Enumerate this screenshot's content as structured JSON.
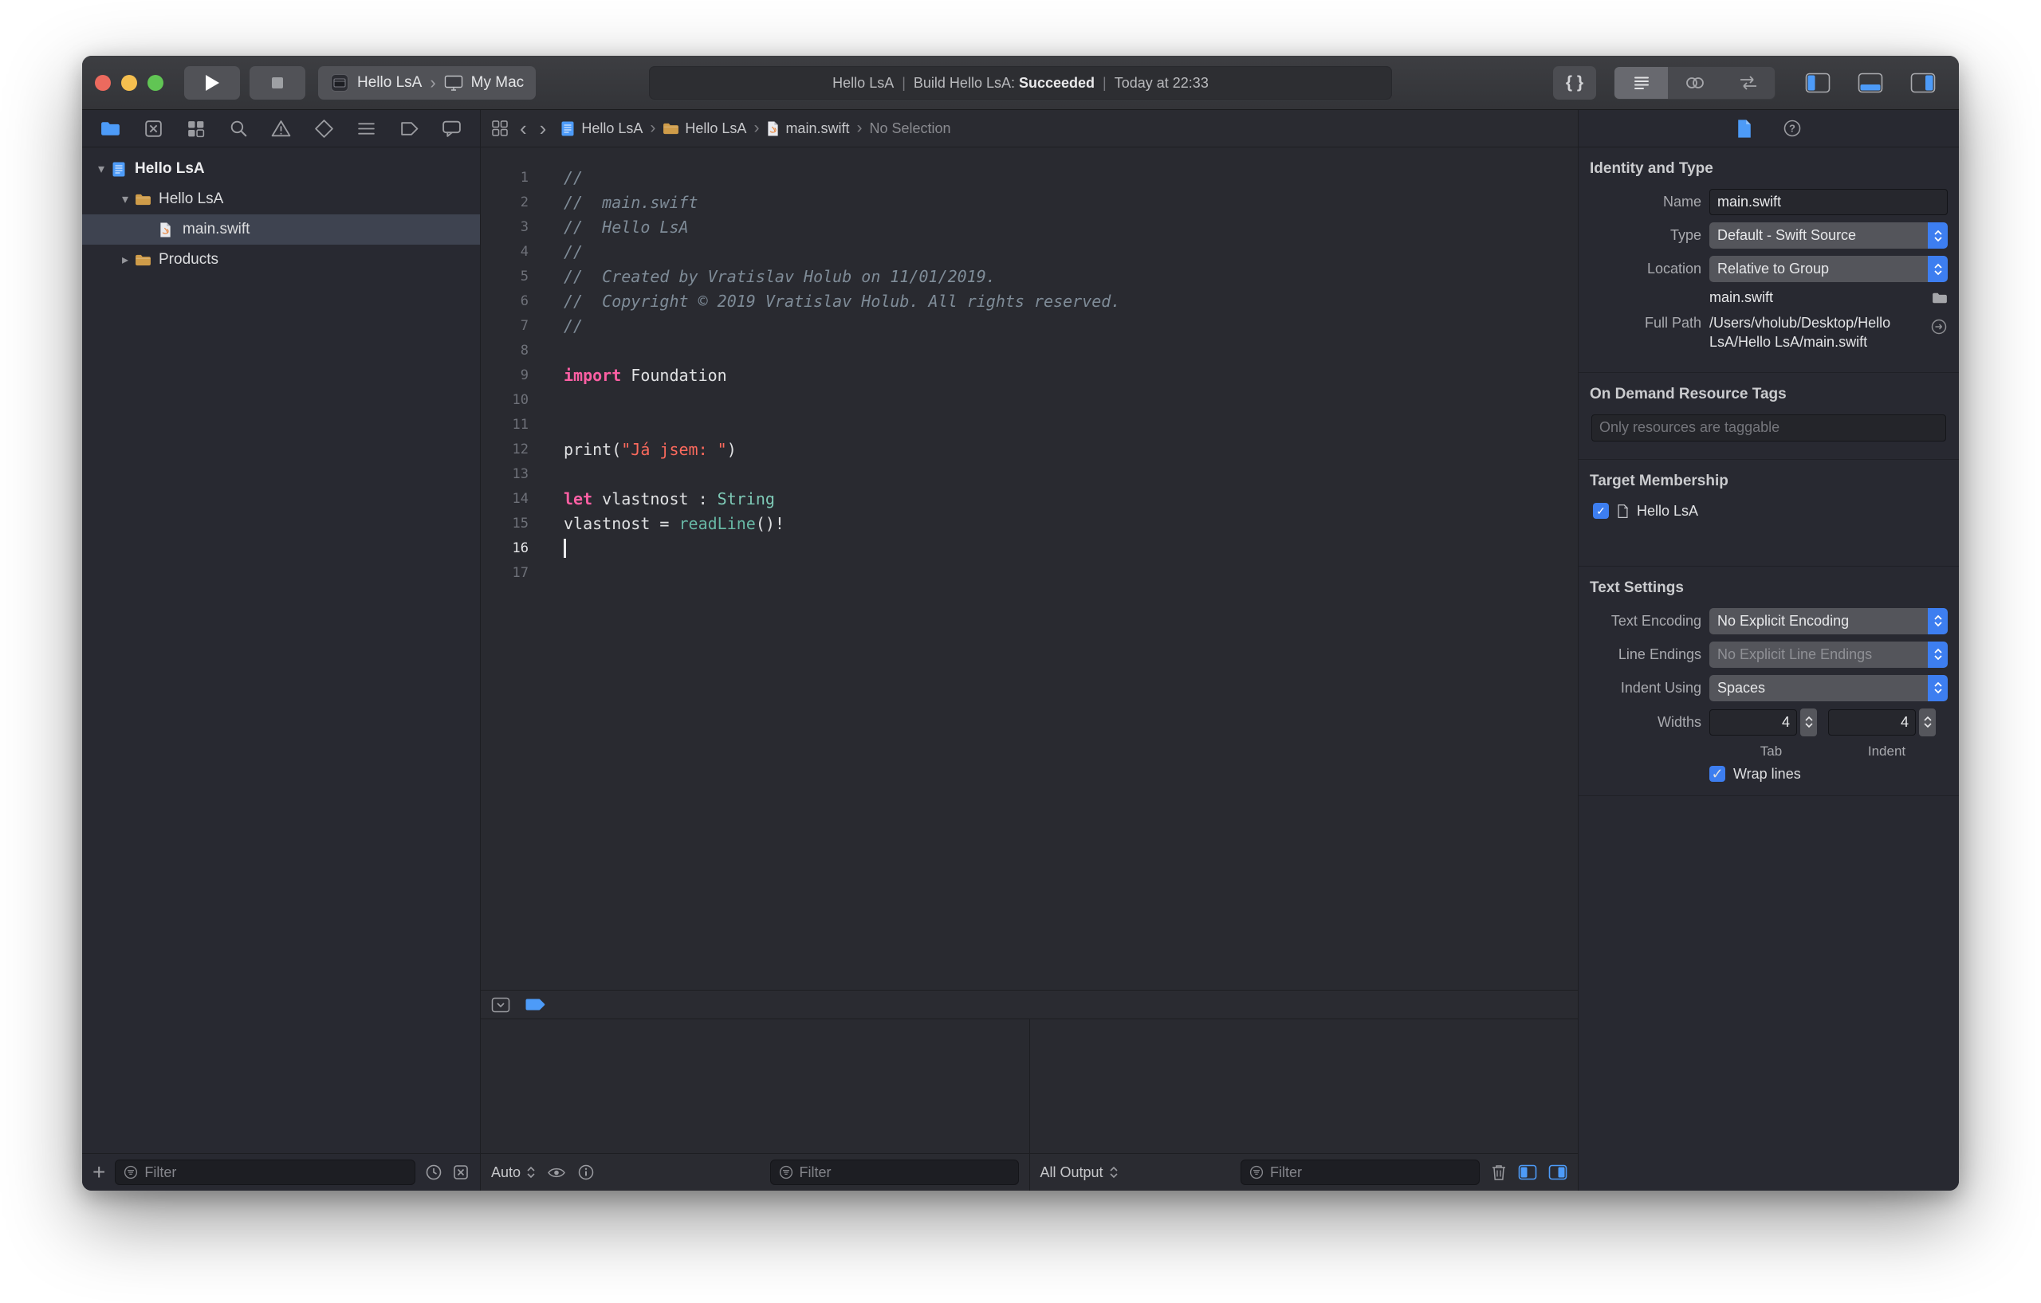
{
  "colors": {
    "accent_blue": "#4D9BF8",
    "traffic_red": "#EC6A5E",
    "traffic_yellow": "#F5BF4F",
    "traffic_green": "#61C554",
    "folder_yellow": "#CF9C49",
    "selection_row": "#3E4350",
    "code_comment": "#7F8C98",
    "code_keyword": "#FC5FA3",
    "code_string": "#FC6A5D",
    "code_type": "#7EC9B6",
    "code_call": "#67B7A4",
    "code_plain": "#E0E1E3"
  },
  "toolbar": {
    "scheme_name": "Hello LsA",
    "destination_name": "My Mac",
    "status": {
      "project": "Hello LsA",
      "separator": "|",
      "action": "Build Hello LsA:",
      "result": "Succeeded",
      "time": "Today at 22:33"
    }
  },
  "navigator": {
    "filter_placeholder": "Filter",
    "tree": [
      {
        "label": "Hello LsA",
        "icon": "project",
        "level": 0,
        "disclosure": "open",
        "selected": false
      },
      {
        "label": "Hello LsA",
        "icon": "folder",
        "level": 1,
        "disclosure": "open",
        "selected": false
      },
      {
        "label": "main.swift",
        "icon": "swift-file",
        "level": 2,
        "disclosure": "none",
        "selected": true
      },
      {
        "label": "Products",
        "icon": "folder",
        "level": 1,
        "disclosure": "closed",
        "selected": false
      }
    ]
  },
  "editor": {
    "breadcrumb_separator": "›",
    "breadcrumbs": [
      {
        "label": "Hello LsA",
        "icon": "project",
        "dim": false
      },
      {
        "label": "Hello LsA",
        "icon": "folder",
        "dim": false
      },
      {
        "label": "main.swift",
        "icon": "swift-file",
        "dim": false
      },
      {
        "label": "No Selection",
        "icon": "none",
        "dim": true
      }
    ],
    "lines": [
      {
        "num": 1,
        "segments": [
          {
            "t": "comment",
            "text": "//"
          }
        ]
      },
      {
        "num": 2,
        "segments": [
          {
            "t": "comment",
            "text": "//  main.swift"
          }
        ]
      },
      {
        "num": 3,
        "segments": [
          {
            "t": "comment",
            "text": "//  Hello LsA"
          }
        ]
      },
      {
        "num": 4,
        "segments": [
          {
            "t": "comment",
            "text": "//"
          }
        ]
      },
      {
        "num": 5,
        "segments": [
          {
            "t": "comment",
            "text": "//  Created by Vratislav Holub on 11/01/2019."
          }
        ]
      },
      {
        "num": 6,
        "segments": [
          {
            "t": "comment",
            "text": "//  Copyright © 2019 Vratislav Holub. All rights reserved."
          }
        ]
      },
      {
        "num": 7,
        "segments": [
          {
            "t": "comment",
            "text": "//"
          }
        ]
      },
      {
        "num": 8,
        "segments": []
      },
      {
        "num": 9,
        "segments": [
          {
            "t": "keyword",
            "text": "import"
          },
          {
            "t": "plain",
            "text": " Foundation"
          }
        ]
      },
      {
        "num": 10,
        "segments": []
      },
      {
        "num": 11,
        "segments": []
      },
      {
        "num": 12,
        "segments": [
          {
            "t": "plain",
            "text": "print("
          },
          {
            "t": "string",
            "text": "\"Já jsem: \""
          },
          {
            "t": "plain",
            "text": ")"
          }
        ]
      },
      {
        "num": 13,
        "segments": []
      },
      {
        "num": 14,
        "segments": [
          {
            "t": "keyword",
            "text": "let"
          },
          {
            "t": "plain",
            "text": " vlastnost : "
          },
          {
            "t": "type",
            "text": "String"
          }
        ]
      },
      {
        "num": 15,
        "segments": [
          {
            "t": "plain",
            "text": "vlastnost = "
          },
          {
            "t": "call",
            "text": "readLine"
          },
          {
            "t": "plain",
            "text": "()!"
          }
        ]
      },
      {
        "num": 16,
        "segments": [],
        "current": true,
        "caret": true
      },
      {
        "num": 17,
        "segments": []
      }
    ]
  },
  "debug": {
    "variables_pane": {
      "scope": "Auto",
      "filter_placeholder": "Filter"
    },
    "console_pane": {
      "scope": "All Output",
      "filter_placeholder": "Filter"
    }
  },
  "inspector": {
    "identity": {
      "header": "Identity and Type",
      "name_label": "Name",
      "name_value": "main.swift",
      "type_label": "Type",
      "type_value": "Default - Swift Source",
      "location_label": "Location",
      "location_value": "Relative to Group",
      "file_name": "main.swift",
      "fullpath_label": "Full Path",
      "fullpath_value": "/Users/vholub/Desktop/Hello LsA/Hello LsA/main.swift"
    },
    "resource_tags": {
      "header": "On Demand Resource Tags",
      "placeholder": "Only resources are taggable"
    },
    "target_membership": {
      "header": "Target Membership",
      "targets": [
        {
          "name": "Hello LsA",
          "checked": true
        }
      ]
    },
    "text_settings": {
      "header": "Text Settings",
      "encoding_label": "Text Encoding",
      "encoding_value": "No Explicit Encoding",
      "line_endings_label": "Line Endings",
      "line_endings_value": "No Explicit Line Endings",
      "indent_label": "Indent Using",
      "indent_value": "Spaces",
      "widths_label": "Widths",
      "tab_width": "4",
      "indent_width": "4",
      "tab_caption": "Tab",
      "indent_caption": "Indent",
      "wrap_label": "Wrap lines",
      "wrap_checked": true
    }
  }
}
